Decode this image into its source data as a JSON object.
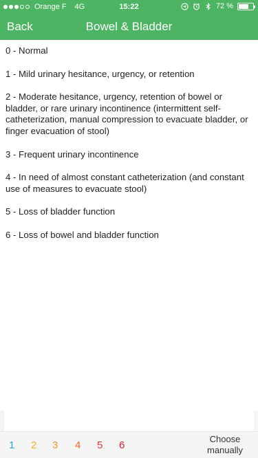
{
  "status_bar": {
    "carrier": "Orange F",
    "network": "4G",
    "time": "15:22",
    "battery": "72 %",
    "battery_fraction": 0.72,
    "icons": [
      "signal-dots",
      "location-icon",
      "alarm-icon",
      "bluetooth-icon",
      "battery-icon"
    ]
  },
  "nav": {
    "back_label": "Back",
    "title": "Bowel & Bladder"
  },
  "options": [
    "0 - Normal",
    "1 - Mild urinary hesitance, urgency, or retention",
    "2 - Moderate hesitance, urgency, retention of bowel or bladder, or rare urinary incontinence (intermittent self-catheterization, manual compression to evacuate bladder, or finger evacuation of stool)",
    "3 - Frequent urinary incontinence",
    "4 - In need of almost constant catheterization (and constant use of measures to evacuate stool)",
    "5 - Loss of bladder function",
    "6 - Loss of bowel and bladder function"
  ],
  "bottom_bar": {
    "scores": [
      {
        "label": "1",
        "color": "#2aa5d8"
      },
      {
        "label": "2",
        "color": "#f2b41f"
      },
      {
        "label": "3",
        "color": "#f0982a"
      },
      {
        "label": "4",
        "color": "#ec6a33"
      },
      {
        "label": "5",
        "color": "#e2383d"
      },
      {
        "label": "6",
        "color": "#d31f2f"
      }
    ],
    "choose_manually": "Choose manually"
  },
  "colors": {
    "accent": "#4cb462"
  }
}
